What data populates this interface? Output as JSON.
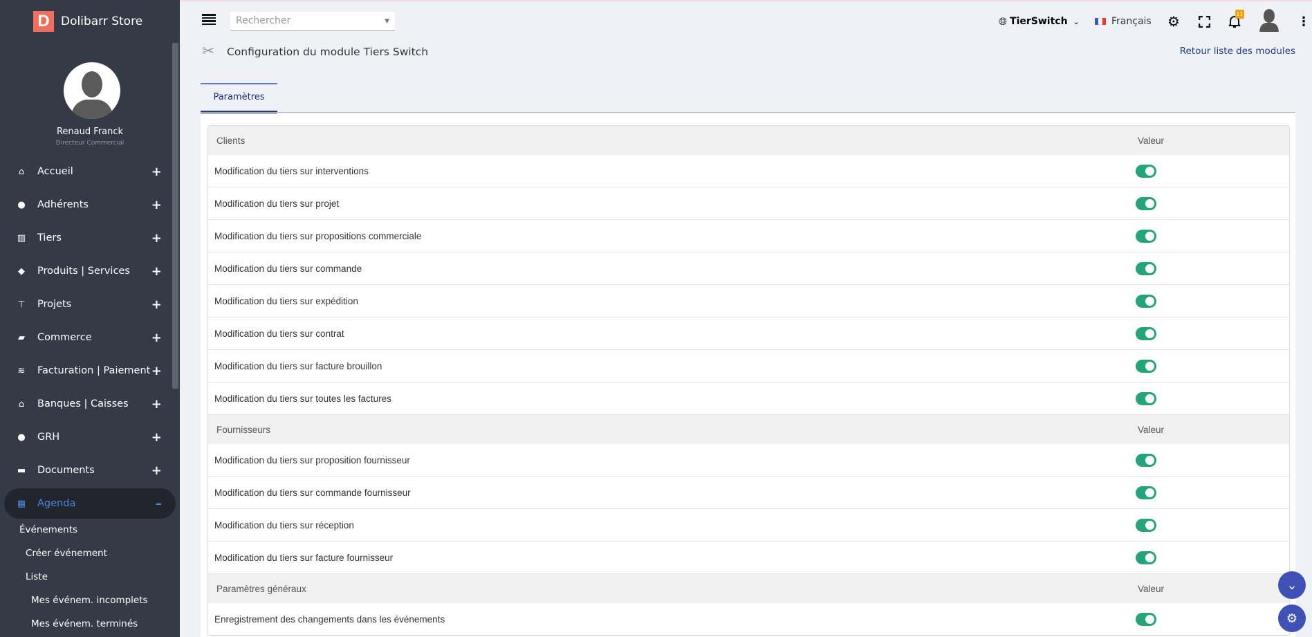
{
  "brand": {
    "logo_letter": "D",
    "name": "Dolibarr Store"
  },
  "user": {
    "name": "Renaud Franck",
    "role": "Directeur Commercial"
  },
  "menu": [
    {
      "label": "Accueil",
      "icon": "home-icon",
      "glyph": "⌂",
      "toggle": "+"
    },
    {
      "label": "Adhérents",
      "icon": "user-icon",
      "glyph": "●",
      "toggle": "+"
    },
    {
      "label": "Tiers",
      "icon": "building-icon",
      "glyph": "▥",
      "toggle": "+"
    },
    {
      "label": "Produits | Services",
      "icon": "box-icon",
      "glyph": "◆",
      "toggle": "+"
    },
    {
      "label": "Projets",
      "icon": "sitemap-icon",
      "glyph": "⊤",
      "toggle": "+"
    },
    {
      "label": "Commerce",
      "icon": "briefcase-icon",
      "glyph": "▰",
      "toggle": "+"
    },
    {
      "label": "Facturation | Paiement",
      "icon": "coins-icon",
      "glyph": "≋",
      "toggle": "+"
    },
    {
      "label": "Banques | Caisses",
      "icon": "bank-icon",
      "glyph": "⌂",
      "toggle": "+"
    },
    {
      "label": "GRH",
      "icon": "user-tie-icon",
      "glyph": "●",
      "toggle": "+"
    },
    {
      "label": "Documents",
      "icon": "folder-icon",
      "glyph": "▬",
      "toggle": "+"
    },
    {
      "label": "Agenda",
      "icon": "calendar-icon",
      "glyph": "▦",
      "toggle": "–",
      "active": true
    }
  ],
  "submenu": [
    {
      "label": "Événements",
      "level": 0
    },
    {
      "label": "Créer événement",
      "level": 1
    },
    {
      "label": "Liste",
      "level": 1
    },
    {
      "label": "Mes événem. incomplets",
      "level": 2
    },
    {
      "label": "Mes événem. terminés",
      "level": 2
    }
  ],
  "topbar": {
    "search_placeholder": "Rechercher",
    "entity": "TierSwitch",
    "language": "Français",
    "notifications": "11"
  },
  "page": {
    "title": "Configuration du module Tiers Switch",
    "back_link": "Retour liste des modules",
    "tab": "Paramètres"
  },
  "sections": [
    {
      "title": "Clients",
      "value_header": "Valeur",
      "rows": [
        {
          "label": "Modification du tiers sur interventions",
          "on": true
        },
        {
          "label": "Modification du tiers sur projet",
          "on": true
        },
        {
          "label": "Modification du tiers sur propositions commerciale",
          "on": true
        },
        {
          "label": "Modification du tiers sur commande",
          "on": true
        },
        {
          "label": "Modification du tiers sur expédition",
          "on": true
        },
        {
          "label": "Modification du tiers sur contrat",
          "on": true
        },
        {
          "label": "Modification du tiers sur facture brouillon",
          "on": true
        },
        {
          "label": "Modification du tiers sur toutes les factures",
          "on": true
        }
      ]
    },
    {
      "title": "Fournisseurs",
      "value_header": "Valeur",
      "rows": [
        {
          "label": "Modification du tiers sur proposition fournisseur",
          "on": true
        },
        {
          "label": "Modification du tiers sur commande fournisseur",
          "on": true
        },
        {
          "label": "Modification du tiers sur réception",
          "on": true
        },
        {
          "label": "Modification du tiers sur facture fournisseur",
          "on": true
        }
      ]
    },
    {
      "title": "Paramètres généraux",
      "value_header": "Valeur",
      "rows": [
        {
          "label": "Enregistrement des changements dans les événements",
          "on": true
        }
      ]
    }
  ],
  "colors": {
    "sidebar": "#353a47",
    "accent": "#4e87e0",
    "toggle_on": "#25a47b",
    "fab": "#3f51b5"
  }
}
